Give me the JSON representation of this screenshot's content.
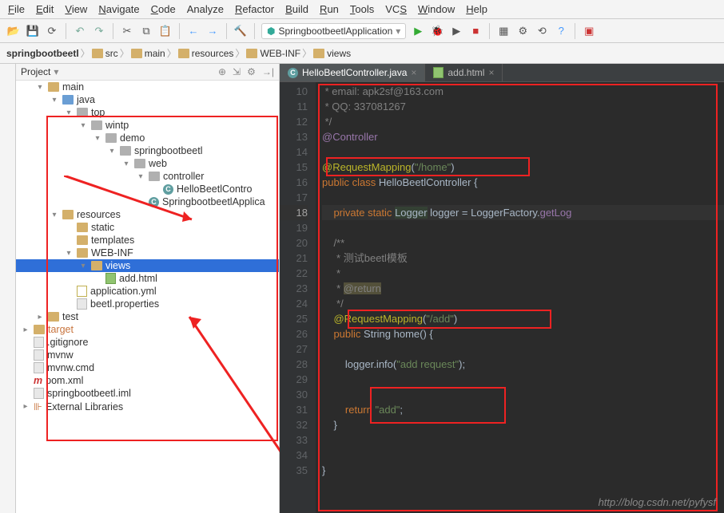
{
  "menu": [
    "File",
    "Edit",
    "View",
    "Navigate",
    "Code",
    "Analyze",
    "Refactor",
    "Build",
    "Run",
    "Tools",
    "VCS",
    "Window",
    "Help"
  ],
  "menu_underline": [
    "F",
    "E",
    "V",
    "N",
    "C",
    "",
    "R",
    "B",
    "R",
    "T",
    "S",
    "W",
    "H"
  ],
  "run_config": "SpringbootbeetlApplication",
  "breadcrumb": [
    "springbootbeetl",
    "src",
    "main",
    "resources",
    "WEB-INF",
    "views"
  ],
  "panel": {
    "title": "Project"
  },
  "tree": {
    "main": "main",
    "java": "java",
    "top": "top",
    "wintp": "wintp",
    "demo": "demo",
    "sbb": "springbootbeetl",
    "web": "web",
    "controller": "controller",
    "hello": "HelloBeetlContro",
    "app": "SpringbootbeetlApplica",
    "resources": "resources",
    "static": "static",
    "templates": "templates",
    "webinf": "WEB-INF",
    "views": "views",
    "addhtml": "add.html",
    "appyml": "application.yml",
    "beetl": "beetl.properties",
    "test": "test",
    "target": "target",
    "gitignore": ".gitignore",
    "mvnw": "mvnw",
    "mvnwcmd": "mvnw.cmd",
    "pom": "pom.xml",
    "iml": "springbootbeetl.iml",
    "extlib": "External Libraries"
  },
  "tabs": [
    {
      "label": "HelloBeetlController.java",
      "active": true
    },
    {
      "label": "add.html",
      "active": false
    }
  ],
  "code": {
    "start": 10,
    "lines": [
      {
        "n": 10,
        "t": " * email: apk2sf@163.com",
        "c": "cmt"
      },
      {
        "n": 11,
        "t": " * QQ: 337081267",
        "c": "cmt"
      },
      {
        "n": 12,
        "t": " */",
        "c": "cmt"
      },
      {
        "n": 13,
        "t": "@Controller",
        "c": "ann2"
      },
      {
        "n": 14,
        "t": "",
        "c": ""
      },
      {
        "n": 15,
        "raw": "<span class='ann'>@RequestMapping</span>(<span class='str'>\"/home\"</span>)"
      },
      {
        "n": 16,
        "raw": "<span class='kw'>public class</span> <span class='cls'>HelloBeetlController</span> {"
      },
      {
        "n": 17,
        "t": "",
        "c": ""
      },
      {
        "n": 18,
        "hl": true,
        "raw": "    <span class='kw'>private static</span> <span class='type'>Logger</span> logger = LoggerFactory.<span style='color:#9876aa'>getLog</span>"
      },
      {
        "n": 19,
        "t": "",
        "c": ""
      },
      {
        "n": 20,
        "t": "    /**",
        "c": "cmt"
      },
      {
        "n": 21,
        "t": "     * 测试beetl模板",
        "c": "cmt"
      },
      {
        "n": 22,
        "t": "     *",
        "c": "cmt"
      },
      {
        "n": 23,
        "raw": "     <span class='cmt'>* </span><span style='background:#53503a;color:#808080'>@return</span>"
      },
      {
        "n": 24,
        "t": "     */",
        "c": "cmt"
      },
      {
        "n": 25,
        "raw": "    <span class='ann'>@RequestMapping</span>(<span class='str'>\"/add\"</span>)"
      },
      {
        "n": 26,
        "raw": "    <span class='kw'>public</span> <span class='cls'>String</span> home() {"
      },
      {
        "n": 27,
        "t": "",
        "c": ""
      },
      {
        "n": 28,
        "raw": "        logger.info(<span class='str'>\"add request\"</span>);"
      },
      {
        "n": 29,
        "t": "",
        "c": ""
      },
      {
        "n": 30,
        "t": "",
        "c": ""
      },
      {
        "n": 31,
        "raw": "        <span class='kw'>return</span> <span class='str'>\"add\"</span>;"
      },
      {
        "n": 32,
        "t": "    }",
        "c": ""
      },
      {
        "n": 33,
        "t": "",
        "c": ""
      },
      {
        "n": 34,
        "t": "",
        "c": ""
      },
      {
        "n": 35,
        "t": "}",
        "c": ""
      }
    ]
  },
  "watermark": "http://blog.csdn.net/pyfysf"
}
